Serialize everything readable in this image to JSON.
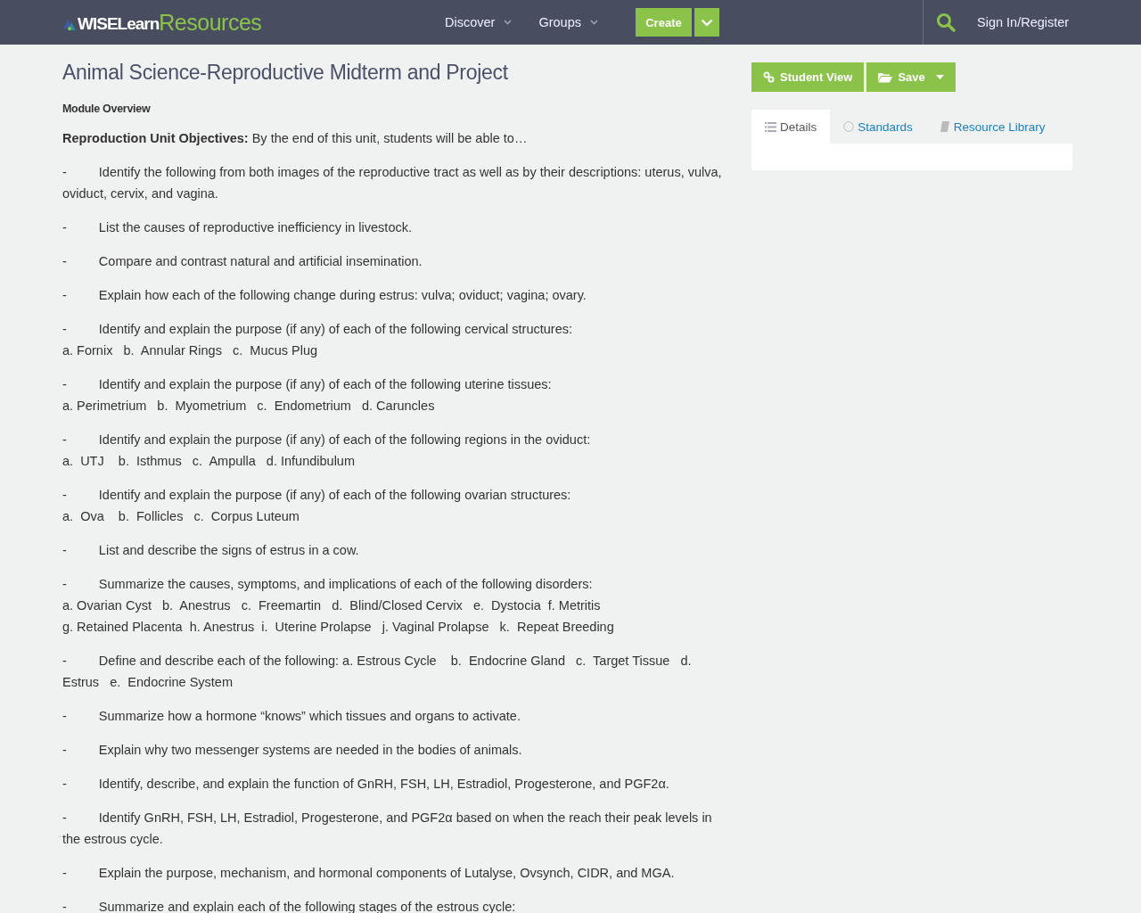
{
  "header": {
    "logo": {
      "brand": "WISELearn",
      "product": "Resources"
    },
    "nav": [
      {
        "label": "Discover"
      },
      {
        "label": "Groups"
      }
    ],
    "create_button": "Create",
    "sign_in": "Sign In/Register"
  },
  "title": "Animal Science-Reproductive Midterm and Project",
  "section_heading": "Module Overview",
  "intro": "**Reproduction Unit Objectives:** By the end of this unit, students will be able to…",
  "objectives": [
    {
      "text": "Identify the following from both images of the reproductive tract as well as by their descriptions: uterus, vulva, oviduct, cervix, and vagina."
    },
    {
      "text": "List the causes of reproductive inefficiency in livestock."
    },
    {
      "text": "Compare and contrast natural and artificial insemination."
    },
    {
      "text": "Explain how each of the following change during estrus: vulva; oviduct; vagina; ovary."
    },
    {
      "text": "Identify and explain the purpose (if any) of each of the following cervical structures:",
      "sub_lines": [
        "a. Fornix   b.  Annular Rings   c.  Mucus Plug"
      ]
    },
    {
      "text": "Identify and explain the purpose (if any) of each of the following uterine tissues:",
      "sub_lines": [
        "a. Perimetrium   b.  Myometrium   c.  Endometrium   d. Caruncles"
      ]
    },
    {
      "text": "Identify and explain the purpose (if any) of each of the following regions in the oviduct:",
      "sub_lines": [
        "a.  UTJ    b.  Isthmus   c.  Ampulla   d. Infundibulum"
      ]
    },
    {
      "text": "Identify and explain the purpose (if any) of each of the following ovarian structures:",
      "sub_lines": [
        "a.  Ova    b.  Follicles   c.  Corpus Luteum"
      ]
    },
    {
      "text": "List and describe the signs of estrus in a cow."
    },
    {
      "text": "Summarize the causes, symptoms, and implications of each of the following disorders:",
      "sub_lines": [
        "a. Ovarian Cyst   b.  Anestrus   c.  Freemartin   d.  Blind/Closed Cervix   e.  Dystocia  f. Metritis",
        "g. Retained Placenta  h. Anestrus  i.  Uterine Prolapse   j. Vaginal Prolapse   k.  Repeat Breeding"
      ]
    },
    {
      "text": "Define and describe each of the following: a. Estrous Cycle    b.  Endocrine Gland   c.  Target Tissue   d. Estrus   e.  Endocrine System"
    },
    {
      "text": "Summarize how a hormone “knows” which tissues and organs to activate."
    },
    {
      "text": "Explain why two messenger systems are needed in the bodies of animals."
    },
    {
      "text": "Identify, describe, and explain the function of GnRH, FSH, LH, Estradiol, Progesterone, and PGF2α."
    },
    {
      "text": "Identify GnRH, FSH, LH, Estradiol, Progesterone, and PGF2α based on when the reach their peak levels in the estrous cycle."
    },
    {
      "text": "Explain the purpose, mechanism, and hormonal components of Lutalyse, Ovsynch, CIDR, and MGA."
    },
    {
      "text": "Summarize and explain each of the following stages of the estrous cycle:"
    }
  ],
  "bullet": "-",
  "actions": [
    {
      "label": "Student View",
      "kind": "link"
    },
    {
      "label": "Save",
      "kind": "save"
    }
  ],
  "tabs": [
    {
      "label": "Details",
      "kind": "list",
      "selected": true
    },
    {
      "label": "Standards",
      "kind": "circle",
      "selected": false
    },
    {
      "label": "Resource Library",
      "kind": "book",
      "selected": false
    }
  ]
}
